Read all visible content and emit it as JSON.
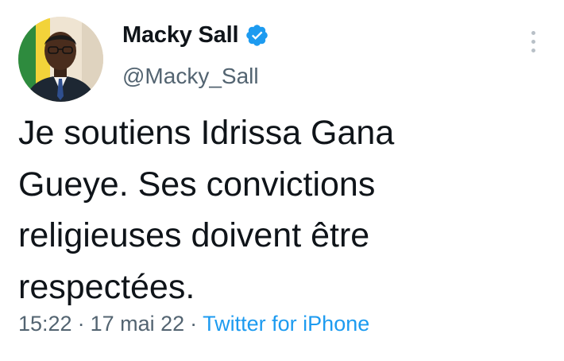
{
  "author": {
    "display_name": "Macky Sall",
    "handle": "@Macky_Sall",
    "verified": true
  },
  "tweet": {
    "lines": [
      "Je soutiens Idrissa Gana",
      "Gueye. Ses convictions",
      "religieuses doivent être",
      "respectées."
    ]
  },
  "meta": {
    "time": "15:22",
    "separator": "·",
    "date": "17 mai 22",
    "source": "Twitter for iPhone"
  },
  "icons": {
    "verified": "verified-badge-icon",
    "more": "more-vertical-icon"
  },
  "colors": {
    "verified_blue": "#1d9bf0",
    "link_blue": "#1d9bf0",
    "secondary_text": "#536471"
  }
}
